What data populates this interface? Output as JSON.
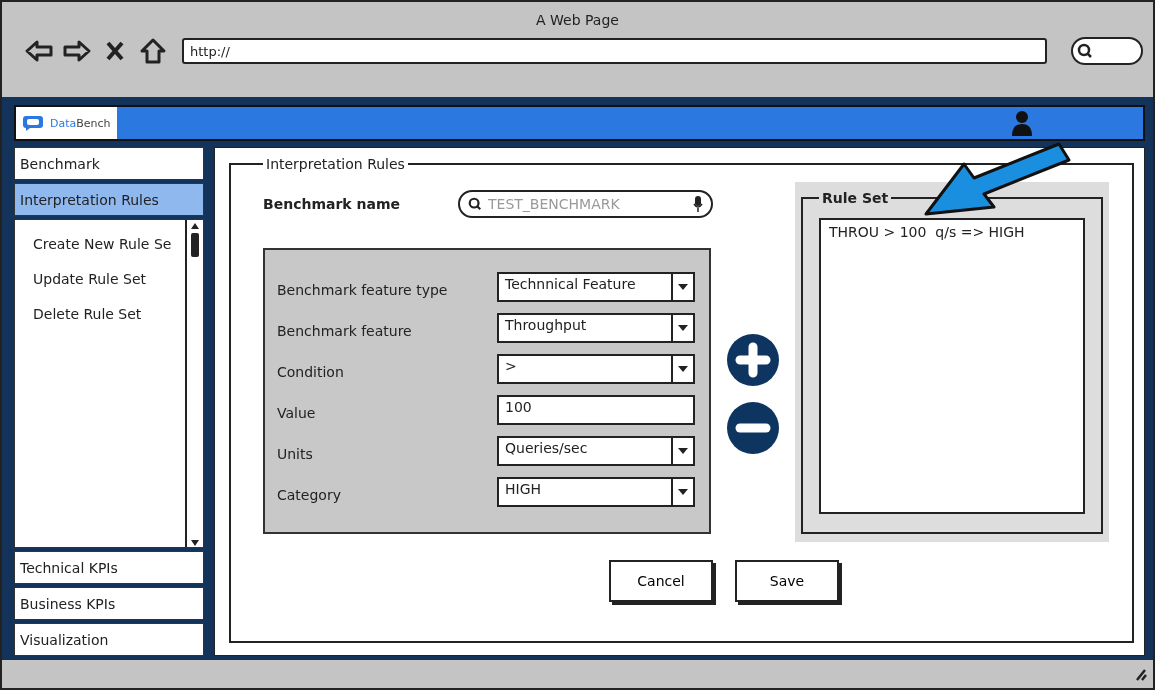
{
  "window": {
    "title": "A Web Page",
    "url": "http://"
  },
  "app": {
    "brand_first": "Data",
    "brand_second": "Bench"
  },
  "sidebar": {
    "items": [
      {
        "label": "Benchmark",
        "selected": false
      },
      {
        "label": "Interpretation Rules",
        "selected": true,
        "expanded": true,
        "children": [
          {
            "label": "Create New Rule Se",
            "selected": false
          },
          {
            "label": "Update Rule Set",
            "selected": false
          },
          {
            "label": "Delete Rule Set",
            "selected": false
          }
        ]
      },
      {
        "label": "Technical KPIs",
        "selected": false
      },
      {
        "label": "Business KPIs",
        "selected": false
      },
      {
        "label": "Visualization",
        "selected": false
      }
    ]
  },
  "panel": {
    "title": "Interpretation Rules",
    "benchmark_name": {
      "label": "Benchmark name",
      "placeholder": "TEST_BENCHMARK"
    },
    "fields": [
      {
        "kind": "select",
        "label": "Benchmark feature type",
        "value": "Technnical Feature"
      },
      {
        "kind": "select",
        "label": "Benchmark feature",
        "value": "Throughput"
      },
      {
        "kind": "select",
        "label": "Condition",
        "value": ">"
      },
      {
        "kind": "text",
        "label": "Value",
        "value": "100"
      },
      {
        "kind": "select",
        "label": "Units",
        "value": "Queries/sec"
      },
      {
        "kind": "select",
        "label": "Category",
        "value": "HIGH"
      }
    ],
    "rule_set": {
      "title": "Rule Set",
      "rules": [
        "THROU > 100  q/s => HIGH"
      ]
    },
    "buttons": [
      "Cancel",
      "Save"
    ]
  }
}
